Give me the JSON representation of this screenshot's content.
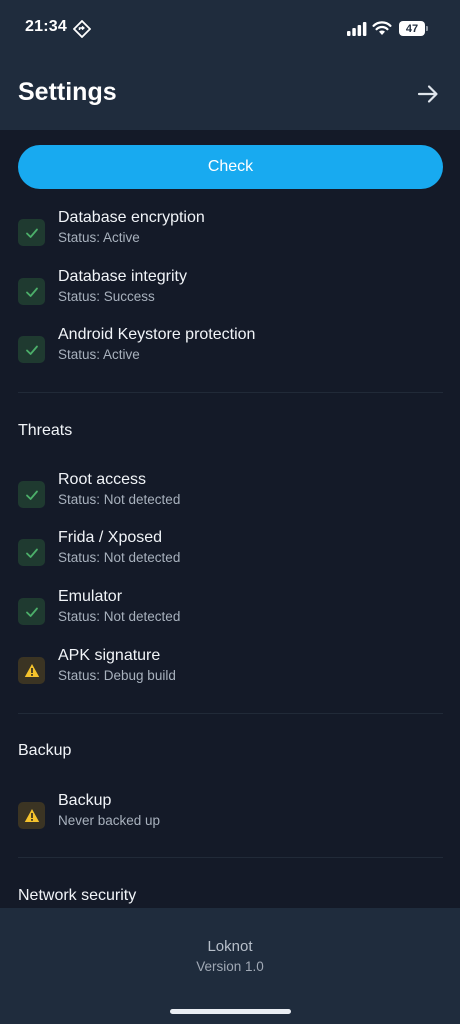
{
  "status_bar": {
    "time": "21:34",
    "battery": "47",
    "icons": [
      "navigation-diamond-icon",
      "signal-icon",
      "wifi-icon",
      "battery-icon"
    ]
  },
  "header": {
    "title": "Settings",
    "action_icon": "arrow-right-icon"
  },
  "check_button": {
    "label": "Check"
  },
  "security_items": [
    {
      "title": "Database encryption",
      "status": "Status: Active",
      "state": "ok"
    },
    {
      "title": "Database integrity",
      "status": "Status: Success",
      "state": "ok"
    },
    {
      "title": "Android Keystore protection",
      "status": "Status: Active",
      "state": "ok"
    }
  ],
  "threats": {
    "heading": "Threats",
    "items": [
      {
        "title": "Root access",
        "status": "Status: Not detected",
        "state": "ok"
      },
      {
        "title": "Frida / Xposed",
        "status": "Status: Not detected",
        "state": "ok"
      },
      {
        "title": "Emulator",
        "status": "Status: Not detected",
        "state": "ok"
      },
      {
        "title": "APK signature",
        "status": "Status: Debug build",
        "state": "warn"
      }
    ]
  },
  "backup": {
    "heading": "Backup",
    "items": [
      {
        "title": "Backup",
        "status": "Never backed up",
        "state": "warn"
      }
    ]
  },
  "network": {
    "heading": "Network security"
  },
  "footer": {
    "app_name": "Loknot",
    "version": "Version 1.0"
  },
  "colors": {
    "accent": "#18aaf0",
    "ok": "#4caf6a",
    "warn": "#f5c32c",
    "header_bg": "#1f2c3d",
    "content_bg": "#141a28"
  }
}
